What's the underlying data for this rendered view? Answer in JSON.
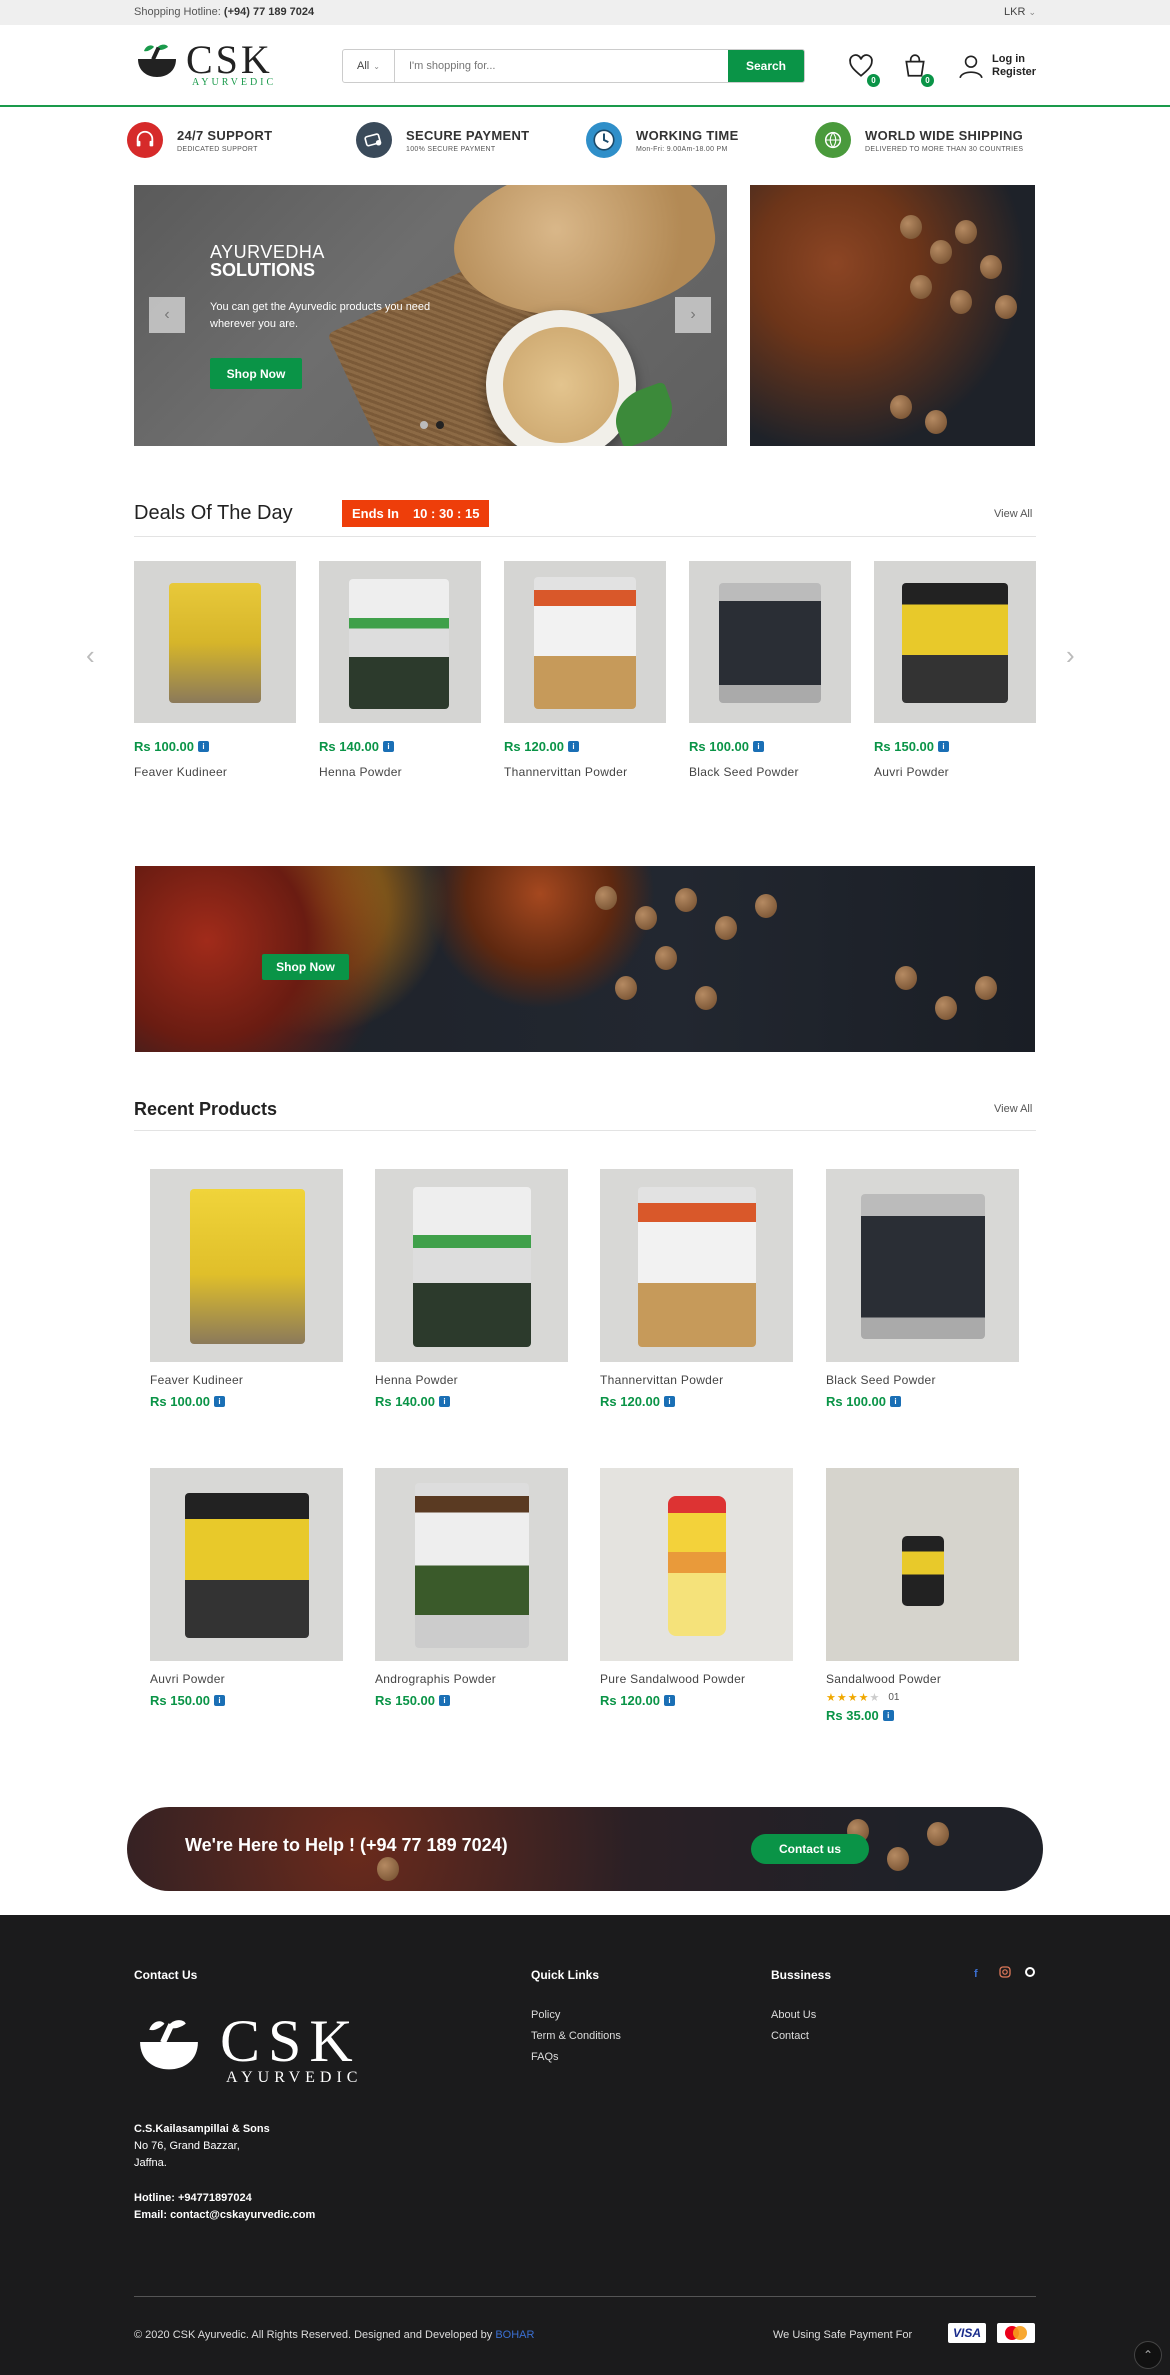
{
  "topbar": {
    "hotline_label": "Shopping Hotline:",
    "hotline_number": "(+94) 77 189 7024",
    "currency": "LKR"
  },
  "header": {
    "logo_text": "CSK",
    "logo_sub": "AYURVEDIC",
    "search_category": "All",
    "search_placeholder": "I'm shopping for...",
    "search_button": "Search",
    "wishlist_count": "0",
    "cart_count": "0",
    "login": "Log in",
    "register": "Register"
  },
  "features": [
    {
      "title": "24/7 SUPPORT",
      "sub": "DEDICATED SUPPORT",
      "color": "#d62a2a"
    },
    {
      "title": "SECURE PAYMENT",
      "sub": "100% SECURE PAYMENT",
      "color": "#3a4a5a"
    },
    {
      "title": "WORKING TIME",
      "sub": "Mon-Fri: 9.00Am-18.00 PM",
      "color": "#2f8fc9"
    },
    {
      "title": "WORLD WIDE SHIPPING",
      "sub": "DELIVERED TO MORE THAN 30 COUNTRIES",
      "color": "#4a9a3c"
    }
  ],
  "hero": {
    "line1": "AYURVEDHA",
    "line2": "SOLUTIONS",
    "text": "You can get the Ayurvedic products you need wherever you are.",
    "button": "Shop Now"
  },
  "deals": {
    "title": "Deals Of The Day",
    "ends_label": "Ends In",
    "ends_time": "10 : 30 : 15",
    "view_all": "View All",
    "items": [
      {
        "price": "Rs 100.00",
        "name": "Feaver Kudineer"
      },
      {
        "price": "Rs 140.00",
        "name": "Henna Powder"
      },
      {
        "price": "Rs 120.00",
        "name": "Thannervittan Powder"
      },
      {
        "price": "Rs 100.00",
        "name": "Black Seed Powder"
      },
      {
        "price": "Rs 150.00",
        "name": "Auvri Powder"
      }
    ]
  },
  "spices_banner": {
    "button": "Shop Now"
  },
  "recent": {
    "title": "Recent Products",
    "view_all": "View All",
    "items": [
      {
        "name": "Feaver Kudineer",
        "price": "Rs 100.00"
      },
      {
        "name": "Henna Powder",
        "price": "Rs 140.00"
      },
      {
        "name": "Thannervittan Powder",
        "price": "Rs 120.00"
      },
      {
        "name": "Black Seed Powder",
        "price": "Rs 100.00"
      },
      {
        "name": "Auvri Powder",
        "price": "Rs 150.00"
      },
      {
        "name": "Andrographis Powder",
        "price": "Rs 150.00"
      },
      {
        "name": "Pure Sandalwood Powder",
        "price": "Rs 120.00"
      },
      {
        "name": "Sandalwood Powder",
        "price": "Rs 35.00",
        "rating": 4,
        "review_count": "01"
      }
    ]
  },
  "help": {
    "text": "We're Here to Help ! (+94 77 189 7024)",
    "button": "Contact us"
  },
  "footer": {
    "contact_title": "Contact Us",
    "logo_text": "CSK",
    "logo_sub": "AYURVEDIC",
    "company": "C.S.Kailasampillai & Sons",
    "address1": "No 76, Grand Bazzar,",
    "address2": "Jaffna.",
    "hotline": "Hotline: +94771897024",
    "email": "Email: contact@cskayurvedic.com",
    "quick_title": "Quick Links",
    "quick_links": [
      "Policy",
      "Term & Conditions",
      "FAQs"
    ],
    "business_title": "Bussiness",
    "business_links": [
      "About Us",
      "Contact"
    ],
    "copyright": "© 2020 CSK Ayurvedic. All Rights Reserved. Designed and Developed by ",
    "developer": "BOHAR",
    "safe_payment": "We Using Safe Payment For",
    "card1": "VISA"
  }
}
